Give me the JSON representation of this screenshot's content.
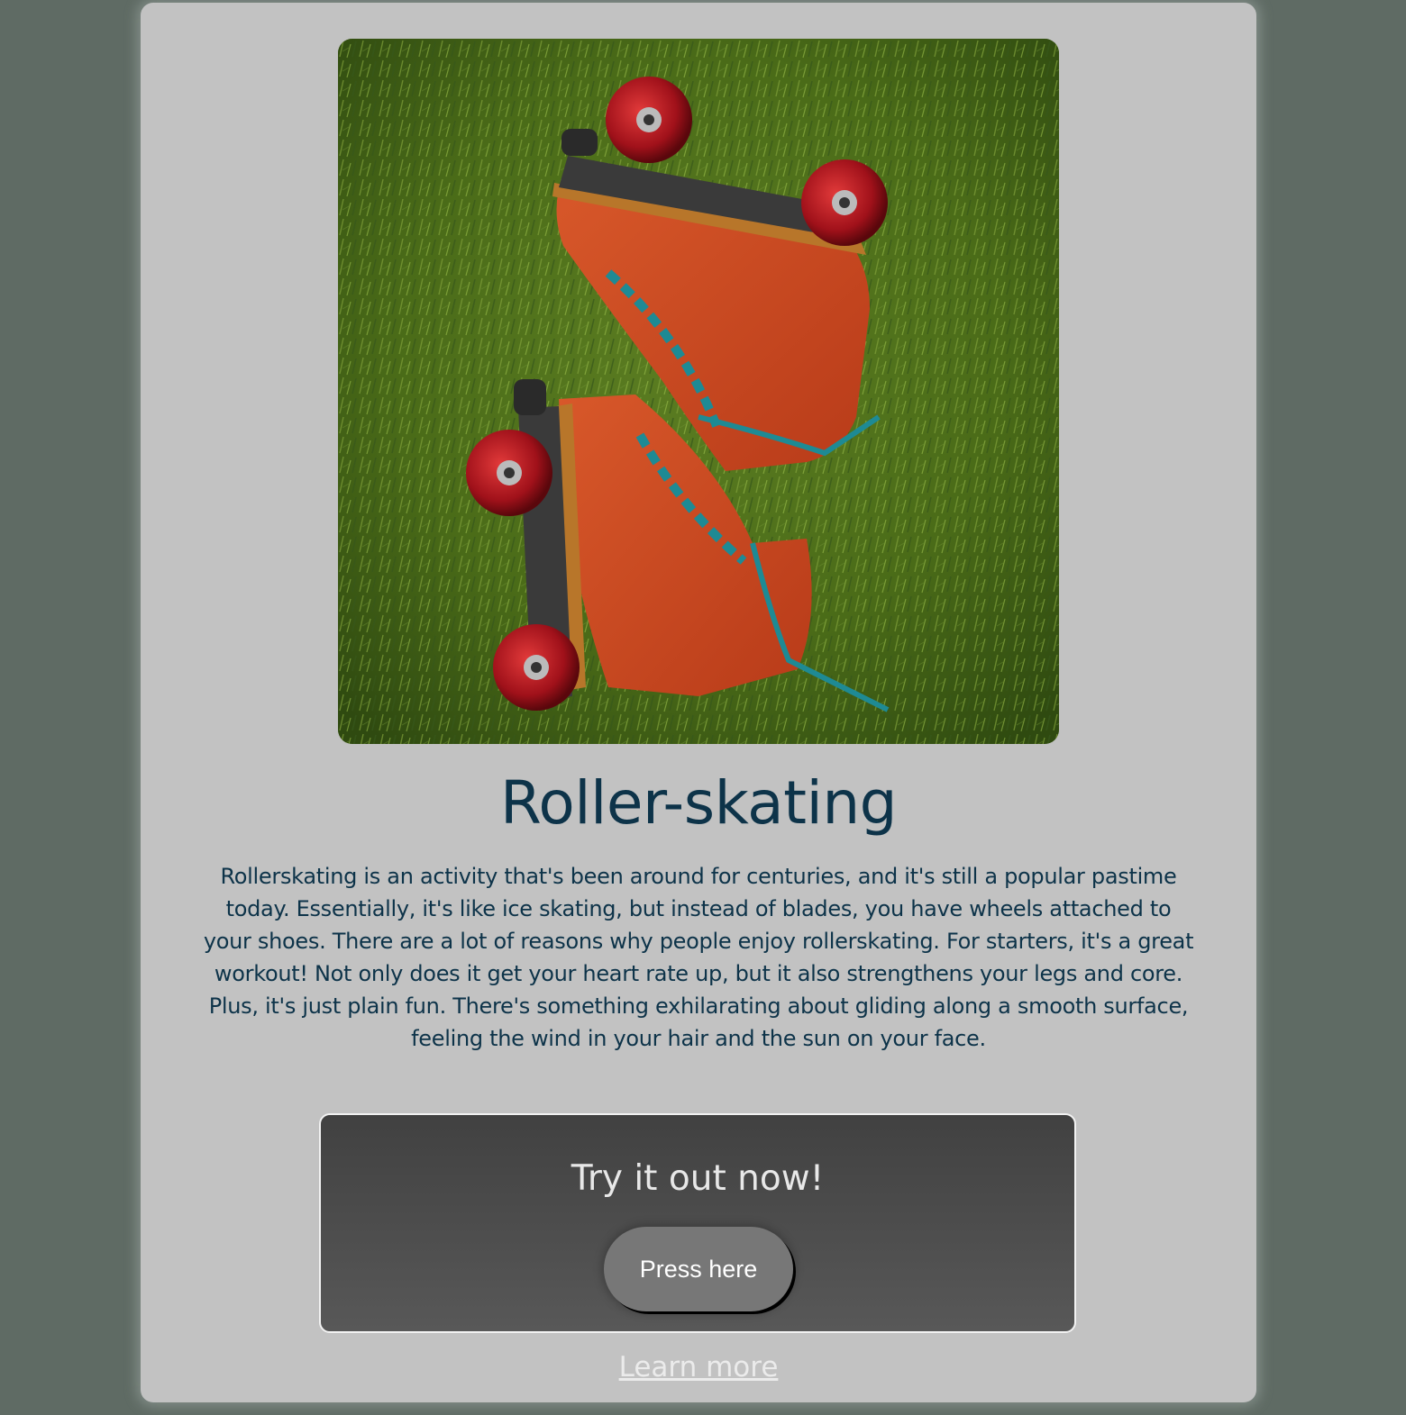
{
  "hero_image": {
    "alt": "Pair of orange suede roller skates with red wheels lying on grass"
  },
  "title": "Roller-skating",
  "description": "Rollerskating is an activity that's been around for centuries, and it's still a popular pastime today. Essentially, it's like ice skating, but instead of blades, you have wheels attached to your shoes. There are a lot of reasons why people enjoy rollerskating. For starters, it's a great workout! Not only does it get your heart rate up, but it also strengthens your legs and core. Plus, it's just plain fun. There's something exhilarating about gliding along a smooth surface, feeling the wind in your hair and the sun on your face.",
  "cta": {
    "heading": "Try it out now!",
    "button_label": "Press here"
  },
  "learn_more_label": "Learn more",
  "colors": {
    "page_background": "#5f6b64",
    "card_background": "#c2c2c2",
    "text": "#0d3349",
    "cta_gradient_top": "#414141",
    "cta_gradient_bottom": "#585858",
    "button": "#777777"
  }
}
